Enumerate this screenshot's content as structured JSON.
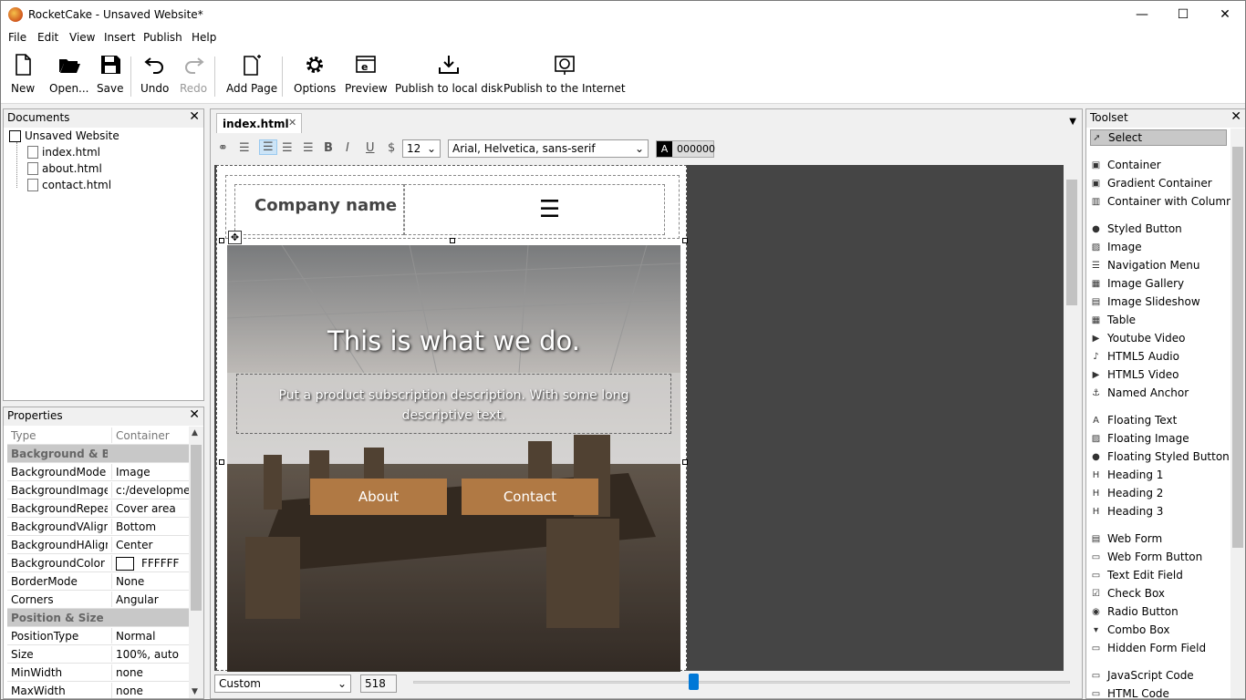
{
  "window": {
    "title": "RocketCake - Unsaved Website*",
    "minimize": "—",
    "maximize": "☐",
    "close": "✕"
  },
  "menu": [
    "File",
    "Edit",
    "View",
    "Insert",
    "Publish",
    "Help"
  ],
  "toolbar": {
    "new": "New",
    "open": "Open...",
    "save": "Save",
    "undo": "Undo",
    "redo": "Redo",
    "add_page": "Add Page",
    "options": "Options",
    "preview": "Preview",
    "publish_local": "Publish to local disk",
    "publish_internet": "Publish to the Internet"
  },
  "documents": {
    "header": "Documents",
    "close": "✕",
    "root": "Unsaved Website",
    "files": [
      "index.html",
      "about.html",
      "contact.html"
    ]
  },
  "properties": {
    "header": "Properties",
    "close": "✕",
    "rows": [
      {
        "k": "Type",
        "v": "Container",
        "kind": "type"
      },
      {
        "k": "Background & Border",
        "v": "",
        "kind": "cat"
      },
      {
        "k": "BackgroundMode",
        "v": "Image"
      },
      {
        "k": "BackgroundImage",
        "v": "c:/development"
      },
      {
        "k": "BackgroundRepeat",
        "v": "Cover area"
      },
      {
        "k": "BackgroundVAlignm",
        "v": "Bottom"
      },
      {
        "k": "BackgroundHAlignn",
        "v": "Center"
      },
      {
        "k": "BackgroundColor",
        "v": "FFFFFF",
        "swatch": "#FFFFFF"
      },
      {
        "k": "BorderMode",
        "v": "None"
      },
      {
        "k": "Corners",
        "v": "Angular"
      },
      {
        "k": "Position & Size",
        "v": "",
        "kind": "cat"
      },
      {
        "k": "PositionType",
        "v": "Normal"
      },
      {
        "k": "Size",
        "v": "100%, auto"
      },
      {
        "k": "MinWidth",
        "v": "none"
      },
      {
        "k": "MaxWidth",
        "v": "none"
      }
    ]
  },
  "editor": {
    "tab": "index.html",
    "tab_close": "✕",
    "font_size": "12",
    "font_family": "Arial, Helvetica, sans-serif",
    "color_label": "A",
    "color_value": "000000",
    "text_color": "#000000"
  },
  "page": {
    "company": "Company name",
    "hamburger": "☰",
    "headline": "This is what we do.",
    "subtitle": "Put a product subscription description. With some long descriptive text.",
    "btn_about": "About",
    "btn_contact": "Contact",
    "button_color": "#b07944"
  },
  "status": {
    "preset": "Custom",
    "width": "518"
  },
  "toolset": {
    "header": "Toolset",
    "close": "✕",
    "groups": [
      [
        {
          "label": "Select",
          "icon": "pointer-icon"
        }
      ],
      [
        {
          "label": "Container",
          "icon": "container-icon"
        },
        {
          "label": "Gradient Container",
          "icon": "gradient-container-icon"
        },
        {
          "label": "Container with Columns",
          "icon": "columns-icon"
        }
      ],
      [
        {
          "label": "Styled Button",
          "icon": "styled-button-icon"
        },
        {
          "label": "Image",
          "icon": "image-icon"
        },
        {
          "label": "Navigation Menu",
          "icon": "navigation-menu-icon"
        },
        {
          "label": "Image Gallery",
          "icon": "image-gallery-icon"
        },
        {
          "label": "Image Slideshow",
          "icon": "slideshow-icon"
        },
        {
          "label": "Table",
          "icon": "table-icon"
        },
        {
          "label": "Youtube Video",
          "icon": "youtube-icon"
        },
        {
          "label": "HTML5 Audio",
          "icon": "audio-icon"
        },
        {
          "label": "HTML5 Video",
          "icon": "video-icon"
        },
        {
          "label": "Named Anchor",
          "icon": "anchor-icon"
        }
      ],
      [
        {
          "label": "Floating Text",
          "icon": "text-icon"
        },
        {
          "label": "Floating Image",
          "icon": "image-icon"
        },
        {
          "label": "Floating Styled Button",
          "icon": "styled-button-icon"
        },
        {
          "label": "Heading 1",
          "icon": "h1-icon"
        },
        {
          "label": "Heading 2",
          "icon": "h2-icon"
        },
        {
          "label": "Heading 3",
          "icon": "h3-icon"
        }
      ],
      [
        {
          "label": "Web Form",
          "icon": "form-icon"
        },
        {
          "label": "Web Form Button",
          "icon": "form-button-icon"
        },
        {
          "label": "Text Edit Field",
          "icon": "text-field-icon"
        },
        {
          "label": "Check Box",
          "icon": "checkbox-icon"
        },
        {
          "label": "Radio Button",
          "icon": "radio-icon"
        },
        {
          "label": "Combo Box",
          "icon": "combobox-icon"
        },
        {
          "label": "Hidden Form Field",
          "icon": "hidden-field-icon"
        }
      ],
      [
        {
          "label": "JavaScript Code",
          "icon": "javascript-icon"
        },
        {
          "label": "HTML Code",
          "icon": "html-icon"
        }
      ]
    ]
  }
}
